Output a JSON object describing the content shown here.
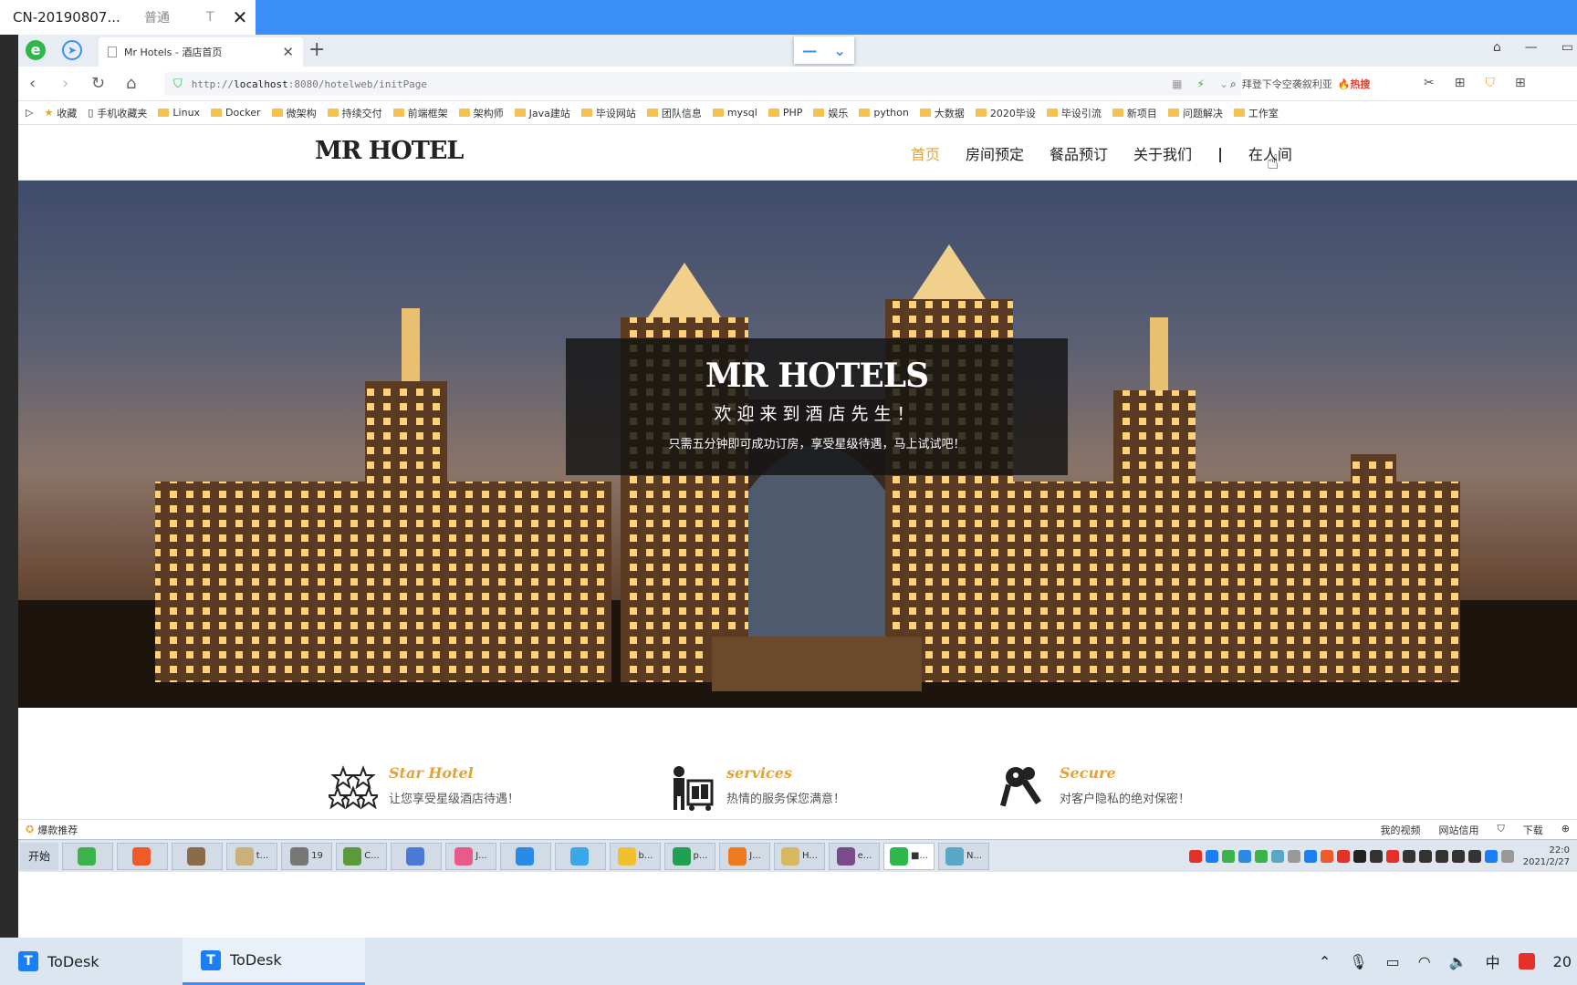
{
  "remote_window": {
    "title": "CN-20190807...",
    "quality": "普通",
    "t_label": "T",
    "close_label": "✕"
  },
  "browser": {
    "logo_e": "e",
    "logo_nav": "➤",
    "tab_title": "Mr Hotels - 酒店首页",
    "tab_close": "✕",
    "newtab": "+",
    "dropdown_minus": "—",
    "dropdown_chevron": "⌄",
    "url_prefix": "http://",
    "url_host": "localhost",
    "url_rest": ":8080/hotelweb/initPage",
    "search_query": "拜登下令空袭叙利亚",
    "search_hot": "🔥热搜",
    "win_min": "—",
    "win_restore": "▭"
  },
  "bookmarks": [
    "收藏",
    "手机收藏夹",
    "Linux",
    "Docker",
    "微架构",
    "持续交付",
    "前端框架",
    "架构师",
    "Java建站",
    "毕设网站",
    "团队信息",
    "mysql",
    "PHP",
    "娱乐",
    "python",
    "大数据",
    "2020毕设",
    "毕设引流",
    "新项目",
    "问题解决",
    "工作室"
  ],
  "site": {
    "logo": "MR HOTEL",
    "nav": {
      "home": "首页",
      "rooms": "房间预定",
      "dining": "餐品预订",
      "about": "关于我们",
      "separator": "|",
      "user": "在人间"
    },
    "hero": {
      "title": "MR HOTELS",
      "subtitle": "欢迎来到酒店先生！",
      "description": "只需五分钟即可成功订房，享受星级待遇，马上试试吧！"
    },
    "features": [
      {
        "title": "Star Hotel",
        "desc": "让您享受星级酒店待遇！",
        "icon": "stars-icon"
      },
      {
        "title": "services",
        "desc": "热情的服务保您满意！",
        "icon": "bellhop-icon"
      },
      {
        "title": "Secure",
        "desc": "对客户隐私的绝对保密！",
        "icon": "keys-icon"
      }
    ]
  },
  "status_bar": {
    "recommend": "爆款推荐",
    "my_video": "我的视频",
    "site_credit": "网站信用",
    "download": "下载"
  },
  "remote_taskbar": {
    "start": "开始",
    "apps": [
      {
        "label": "",
        "color": "#3bb34a"
      },
      {
        "label": "",
        "color": "#f05a28"
      },
      {
        "label": "",
        "color": "#8a6b4a"
      },
      {
        "label": "t...",
        "color": "#c8b27a"
      },
      {
        "label": "19",
        "color": "#777777"
      },
      {
        "label": "C...",
        "color": "#5a9a3a"
      },
      {
        "label": "",
        "color": "#4a7ad8"
      },
      {
        "label": "J...",
        "color": "#e85a8a"
      },
      {
        "label": "",
        "color": "#2a8ae8"
      },
      {
        "label": "",
        "color": "#3aa8e8"
      },
      {
        "label": "b...",
        "color": "#f0c030"
      },
      {
        "label": "p...",
        "color": "#20a050"
      },
      {
        "label": "J...",
        "color": "#f07a20"
      },
      {
        "label": "H...",
        "color": "#d8b860"
      },
      {
        "label": "e...",
        "color": "#7a4a8a"
      },
      {
        "label": "■...",
        "color": "#2eb84b"
      },
      {
        "label": "N...",
        "color": "#5aa8c8"
      }
    ],
    "clock_time": "22:0",
    "clock_date": "2021/2/27"
  },
  "local_taskbar": {
    "tasks": [
      "ToDesk",
      "ToDesk"
    ],
    "tray_ime": "中",
    "tray_time": "20"
  },
  "colors": {
    "accent_gold": "#e2a33a",
    "remote_bar_blue": "#3a8ef5",
    "hero_box": "rgba(20,20,20,0.82)"
  }
}
